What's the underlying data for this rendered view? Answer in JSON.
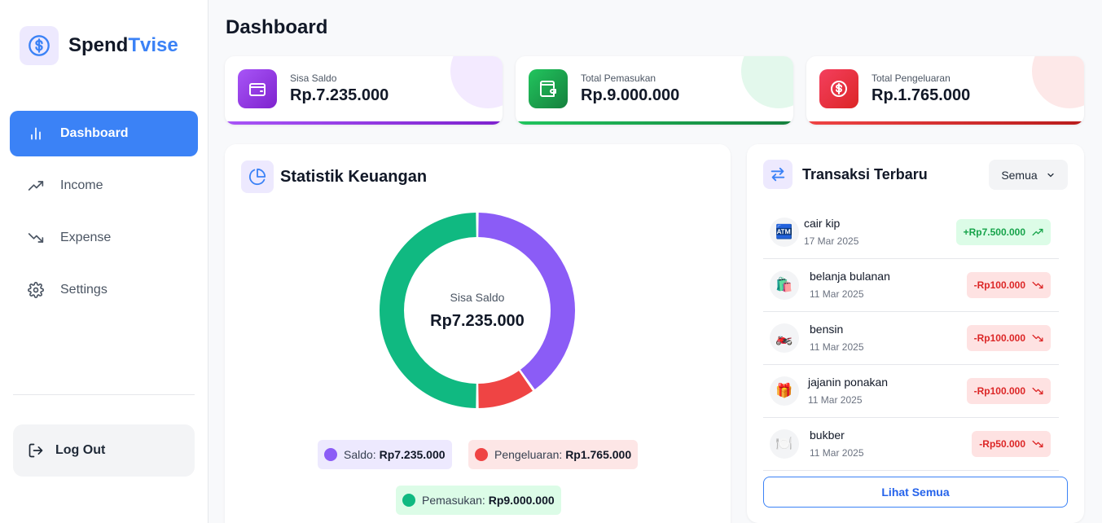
{
  "brand": {
    "name_part1": "Spend",
    "name_part2": "Tvise",
    "logo_icon": "dollar-circle-icon",
    "accent": "#3b82f6"
  },
  "sidebar": {
    "items": [
      {
        "label": "Dashboard",
        "icon": "bar-chart-icon",
        "active": true
      },
      {
        "label": "Income",
        "icon": "trending-up-icon",
        "active": false
      },
      {
        "label": "Expense",
        "icon": "trending-down-icon",
        "active": false
      },
      {
        "label": "Settings",
        "icon": "gear-icon",
        "active": false
      }
    ],
    "logout_label": "Log Out"
  },
  "page": {
    "title": "Dashboard"
  },
  "cards": [
    {
      "label": "Sisa Saldo",
      "value": "Rp.7.235.000",
      "icon": "wallet-icon",
      "color": "#9333ea"
    },
    {
      "label": "Total Pemasukan",
      "value": "Rp.9.000.000",
      "icon": "wallet-in-icon",
      "color": "#16a34a"
    },
    {
      "label": "Total Pengeluaran",
      "value": "Rp.1.765.000",
      "icon": "coin-icon",
      "color": "#dc2626"
    }
  ],
  "stats": {
    "title": "Statistik Keuangan",
    "icon": "pie-chart-icon",
    "center_label": "Sisa Saldo",
    "center_value": "Rp7.235.000",
    "legend": [
      {
        "label": "Saldo:",
        "value": "Rp7.235.000",
        "color": "#8b5cf6"
      },
      {
        "label": "Pengeluaran:",
        "value": "Rp1.765.000",
        "color": "#ef4444"
      },
      {
        "label": "Pemasukan:",
        "value": "Rp9.000.000",
        "color": "#10b981"
      }
    ]
  },
  "chart_data": {
    "type": "pie",
    "categories": [
      "Saldo",
      "Pengeluaran",
      "Pemasukan"
    ],
    "values": [
      7235000,
      1765000,
      9000000
    ],
    "colors": [
      "#8b5cf6",
      "#ef4444",
      "#10b981"
    ]
  },
  "transactions": {
    "title": "Transaksi Terbaru",
    "icon": "swap-arrows-icon",
    "filter_label": "Semua",
    "see_all_label": "Lihat Semua",
    "items": [
      {
        "name": "cair kip",
        "date": "17 Mar 2025",
        "amount": "+Rp7.500.000",
        "type": "income",
        "emoji": "🏧"
      },
      {
        "name": "belanja bulanan",
        "date": "11 Mar 2025",
        "amount": "-Rp100.000",
        "type": "expense",
        "emoji": "🛍️"
      },
      {
        "name": "bensin",
        "date": "11 Mar 2025",
        "amount": "-Rp100.000",
        "type": "expense",
        "emoji": "🏍️"
      },
      {
        "name": "jajanin ponakan",
        "date": "11 Mar 2025",
        "amount": "-Rp100.000",
        "type": "expense",
        "emoji": "🎁"
      },
      {
        "name": "bukber",
        "date": "11 Mar 2025",
        "amount": "-Rp50.000",
        "type": "expense",
        "emoji": "🍽️"
      }
    ]
  }
}
